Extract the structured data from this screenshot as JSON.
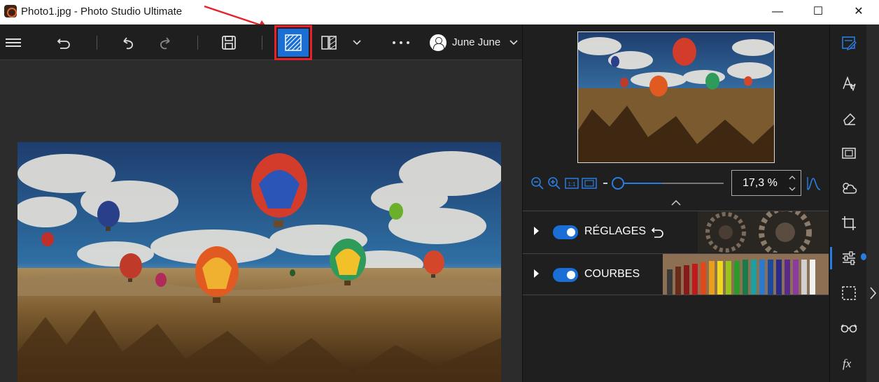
{
  "window": {
    "title": "Photo1.jpg - Photo Studio Ultimate",
    "minimize": "—",
    "maximize": "☐",
    "close": "✕"
  },
  "toolbar": {
    "items": [
      "menu-icon",
      "revert-icon",
      "undo-icon",
      "redo-icon",
      "save-icon",
      "hatch-compare-icon",
      "split-view-icon",
      "chevron-down-icon",
      "more-icon"
    ],
    "highlight_color": "#e8202a",
    "accent": "#1a6fd6"
  },
  "user": {
    "name": "June June"
  },
  "navigator": {
    "zoom_value": "17,3 %"
  },
  "panels": [
    {
      "label": "RÉGLAGES",
      "enabled": true
    },
    {
      "label": "COURBES",
      "enabled": true
    }
  ],
  "sidebar": {
    "icons": [
      "edit-icon",
      "text-effect-icon",
      "eraser-icon",
      "frame-icon",
      "weather-icon",
      "crop-icon",
      "adjust-sliders-icon",
      "selection-icon",
      "glasses-icon",
      "fx-icon"
    ]
  }
}
